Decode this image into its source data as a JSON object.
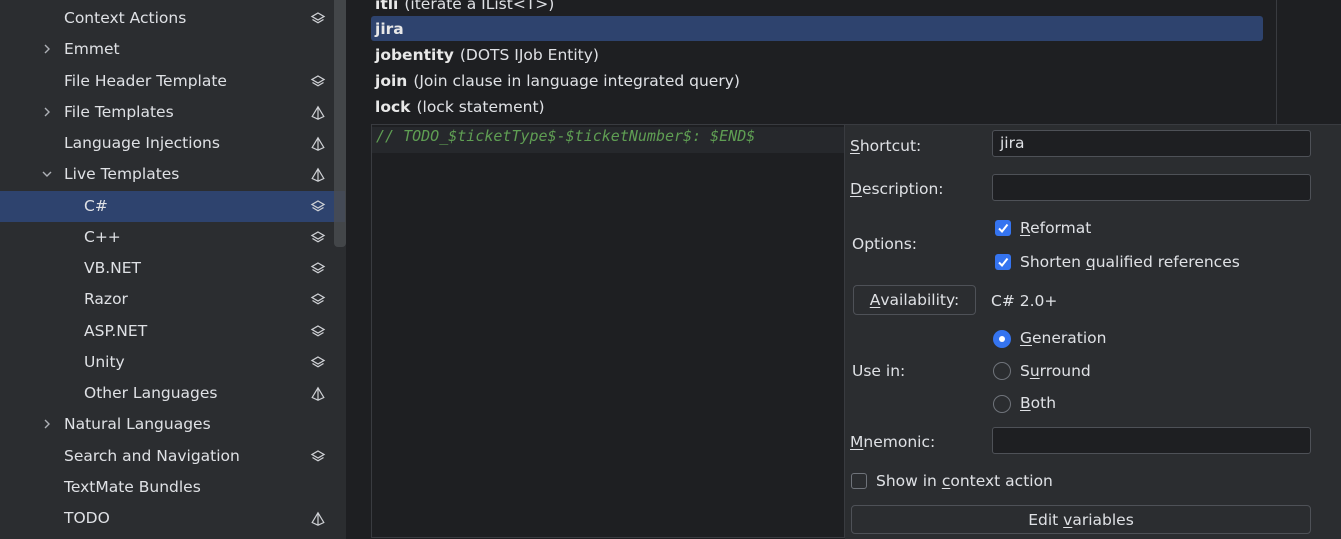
{
  "tree": {
    "items": [
      {
        "label": "Context Actions",
        "expander": "",
        "scope": "layers-icon"
      },
      {
        "label": "Emmet",
        "expander": "collapsed",
        "scope": ""
      },
      {
        "label": "File Header Template",
        "expander": "",
        "scope": "layers-icon"
      },
      {
        "label": "File Templates",
        "expander": "collapsed",
        "scope": "pyramid-icon"
      },
      {
        "label": "Language Injections",
        "expander": "",
        "scope": "pyramid-icon"
      },
      {
        "label": "Live Templates",
        "expander": "expanded",
        "scope": "pyramid-icon"
      },
      {
        "label": "C#",
        "expander": "",
        "scope": "layers-icon",
        "selected": true,
        "child": true
      },
      {
        "label": "C++",
        "expander": "",
        "scope": "layers-icon",
        "child": true
      },
      {
        "label": "VB.NET",
        "expander": "",
        "scope": "layers-icon",
        "child": true
      },
      {
        "label": "Razor",
        "expander": "",
        "scope": "layers-icon",
        "child": true
      },
      {
        "label": "ASP.NET",
        "expander": "",
        "scope": "layers-icon",
        "child": true
      },
      {
        "label": "Unity",
        "expander": "",
        "scope": "layers-icon",
        "child": true
      },
      {
        "label": "Other Languages",
        "expander": "",
        "scope": "pyramid-icon",
        "child": true
      },
      {
        "label": "Natural Languages",
        "expander": "collapsed",
        "scope": ""
      },
      {
        "label": "Search and Navigation",
        "expander": "",
        "scope": "layers-icon"
      },
      {
        "label": "TextMate Bundles",
        "expander": "",
        "scope": ""
      },
      {
        "label": "TODO",
        "expander": "",
        "scope": "pyramid-icon"
      }
    ]
  },
  "templates": {
    "items": [
      {
        "key": "itli",
        "desc": "(iterate a IList<T>)"
      },
      {
        "key": "jira",
        "desc": "",
        "selected": true
      },
      {
        "key": "jobentity",
        "desc": "(DOTS IJob Entity)"
      },
      {
        "key": "join",
        "desc": "(Join clause in language integrated query)"
      },
      {
        "key": "lock",
        "desc": "(lock statement)"
      }
    ]
  },
  "editor": {
    "text": "// TODO_$ticketType$-$ticketNumber$: $END$"
  },
  "props": {
    "shortcut_label": "Shortcut:",
    "shortcut_value": "jira",
    "description_label": "Description:",
    "description_value": "",
    "options_label": "Options:",
    "reformat_label": "Reformat",
    "reformat_checked": true,
    "shorten_label": "Shorten qualified references",
    "shorten_checked": true,
    "availability_button": "Availability:",
    "availability_value": "C# 2.0+",
    "usein_label": "Use in:",
    "radio_generation": "Generation",
    "radio_surround": "Surround",
    "radio_both": "Both",
    "usein_selected": "Generation",
    "mnemonic_label": "Mnemonic:",
    "mnemonic_value": "",
    "context_action_label": "Show in context action",
    "context_action_checked": false,
    "edit_variables_button": "Edit variables"
  },
  "colors": {
    "accent": "#3574f0",
    "selection": "#2e436e",
    "comment": "#5f9e53"
  }
}
